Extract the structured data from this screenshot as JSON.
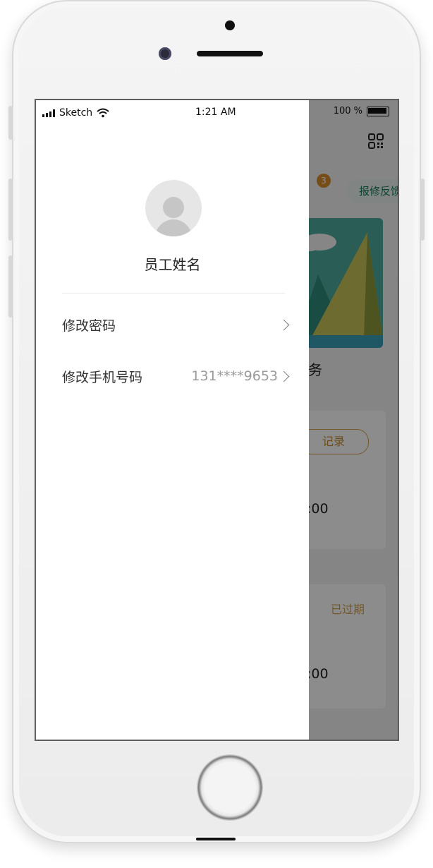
{
  "status_bar": {
    "carrier": "Sketch",
    "time": "1:21 AM",
    "battery": "100 %"
  },
  "drawer": {
    "employee_name": "员工姓名",
    "menu": [
      {
        "label": "修改密码",
        "value": ""
      },
      {
        "label": "修改手机号码",
        "value": "131****9653"
      }
    ]
  },
  "background_app": {
    "badge_count": "3",
    "report_button": "报修反馈",
    "service_text": "务",
    "record_button": "记录",
    "card_time_1": ":00",
    "expired_label": "已过期",
    "card_time_2": ":00"
  },
  "colors": {
    "accent_green": "#1a7a5b",
    "accent_gold": "#d2a24d",
    "badge_orange": "#d98c2b"
  }
}
